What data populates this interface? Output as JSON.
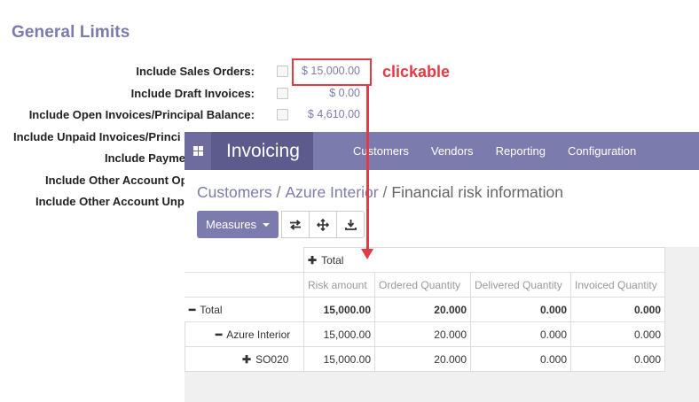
{
  "general_limits": {
    "title": "General Limits",
    "rows": [
      {
        "label": "Include Sales Orders:",
        "value": "$ 15,000.00"
      },
      {
        "label": "Include Draft Invoices:",
        "value": "$ 0.00"
      },
      {
        "label": "Include Open Invoices/Principal Balance:",
        "value": "$ 4,610.00"
      },
      {
        "label": "Include Unpaid Invoices/Princi",
        "value": ""
      },
      {
        "label": "Include Payme",
        "value": ""
      },
      {
        "label": "Include Other Account Op",
        "value": ""
      },
      {
        "label": "Include Other Account Unp",
        "value": ""
      }
    ]
  },
  "annotation": {
    "label": "clickable",
    "color": "#e23b45"
  },
  "invoicing": {
    "brand": "Invoicing",
    "menu": [
      "Customers",
      "Vendors",
      "Reporting",
      "Configuration"
    ],
    "breadcrumb": {
      "item1": "Customers",
      "item2": "Azure Interior",
      "current": "Financial risk information",
      "separator": "/"
    },
    "toolbar": {
      "measures": "Measures"
    }
  },
  "pivot": {
    "col_header": "Total",
    "measures": [
      "Risk amount",
      "Ordered Quantity",
      "Delivered Quantity",
      "Invoiced Quantity"
    ],
    "rows": [
      {
        "label": "Total",
        "values": [
          "15,000.00",
          "20.000",
          "0.000",
          "0.000"
        ]
      },
      {
        "label": "Azure Interior",
        "values": [
          "15,000.00",
          "20.000",
          "0.000",
          "0.000"
        ]
      },
      {
        "label": "SO020",
        "values": [
          "15,000.00",
          "20.000",
          "0.000",
          "0.000"
        ]
      }
    ]
  },
  "colors": {
    "accent": "#7c7bad",
    "brand_dark": "#5d5b8d",
    "annotation": "#e23b45"
  }
}
